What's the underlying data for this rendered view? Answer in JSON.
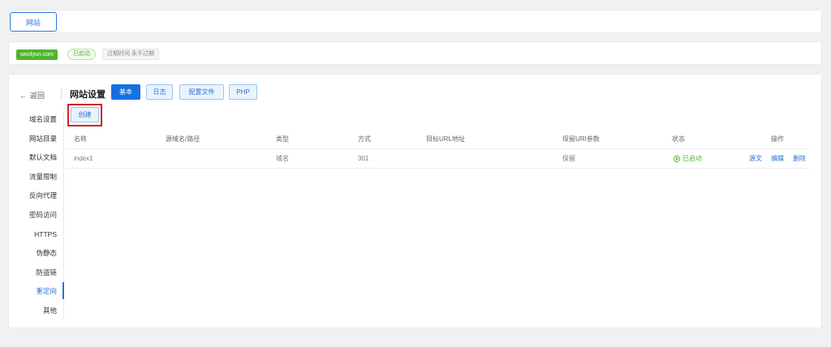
{
  "header": {
    "tab_label": "网站"
  },
  "site": {
    "domain": "woolyun.com",
    "status": "已启动",
    "expiry": "过期时间 永不过期"
  },
  "settings": {
    "back_label": "返回",
    "title": "网站设置",
    "tabs": [
      {
        "label": "基本",
        "active": true
      },
      {
        "label": "日志",
        "active": false
      },
      {
        "label": "配置文件",
        "active": false
      },
      {
        "label": "PHP",
        "active": false
      }
    ]
  },
  "sidebar": {
    "items": [
      {
        "label": "域名设置"
      },
      {
        "label": "网站目录"
      },
      {
        "label": "默认文档"
      },
      {
        "label": "流量限制"
      },
      {
        "label": "反向代理"
      },
      {
        "label": "密码访问"
      },
      {
        "label": "HTTPS"
      },
      {
        "label": "伪静态"
      },
      {
        "label": "防盗链"
      },
      {
        "label": "重定向",
        "active": true
      },
      {
        "label": "其他"
      }
    ]
  },
  "toolbar": {
    "create_label": "创建"
  },
  "table": {
    "columns": [
      "名称",
      "源域名/路径",
      "类型",
      "方式",
      "目标URL地址",
      "保留URI参数",
      "状态",
      "操作"
    ],
    "rows": [
      {
        "name": "index1",
        "source": "",
        "type": "域名",
        "method": "301",
        "target": "",
        "keep_uri": "保留",
        "status": "已启动",
        "actions": [
          "源文",
          "编辑",
          "删除"
        ]
      }
    ]
  },
  "colors": {
    "accent": "#2a73d9",
    "success": "#52b52f",
    "highlight": "#d42020"
  }
}
